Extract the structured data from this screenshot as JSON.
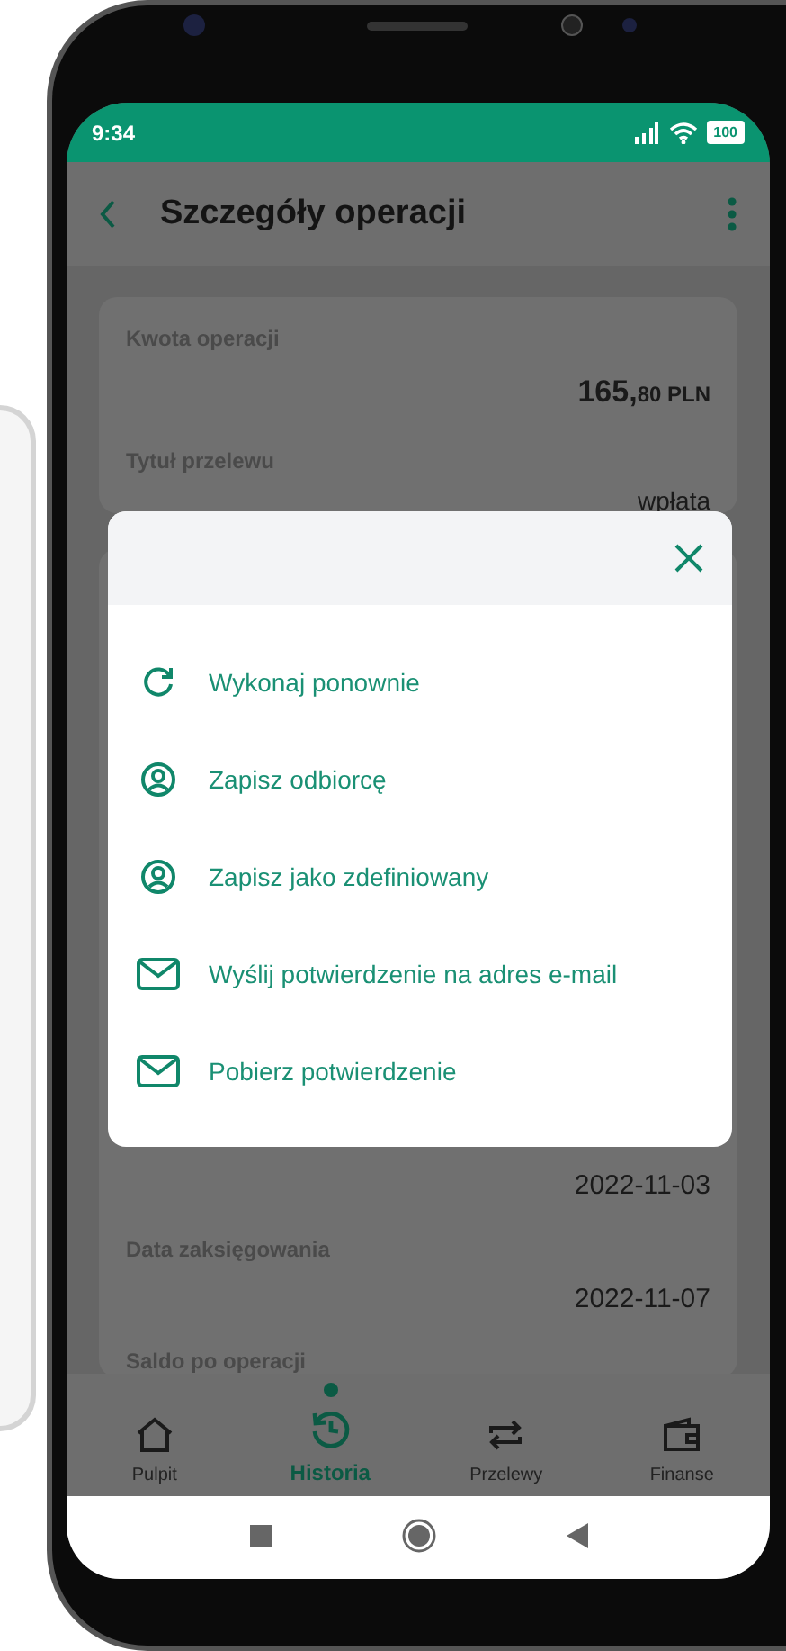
{
  "status_bar": {
    "time": "9:34",
    "battery": "100"
  },
  "header": {
    "title": "Szczegóły operacji"
  },
  "details_top": [
    {
      "label": "Kwota operacji",
      "amount": "165,",
      "amount_small": "80 PLN"
    },
    {
      "label": "Tytuł przelewu",
      "value": "wpłata"
    }
  ],
  "details_bottom": [
    {
      "value": "2022-11-03"
    },
    {
      "label": "Data zaksięgowania",
      "value": "2022-11-07"
    },
    {
      "label": "Saldo po operacji"
    }
  ],
  "menu": {
    "items": [
      {
        "kind": "repeat",
        "label": "Wykonaj ponownie"
      },
      {
        "kind": "person",
        "label": "Zapisz odbiorcę"
      },
      {
        "kind": "person",
        "label": "Zapisz jako zdefiniowany"
      },
      {
        "kind": "mail",
        "label": "Wyślij potwierdzenie na adres e-mail"
      },
      {
        "kind": "mail",
        "label": "Pobierz potwierdzenie"
      }
    ]
  },
  "bottom_nav": [
    {
      "kind": "home",
      "label": "Pulpit",
      "selected": false
    },
    {
      "kind": "history",
      "label": "Historia",
      "selected": true
    },
    {
      "kind": "transfer",
      "label": "Przelewy",
      "selected": false
    },
    {
      "kind": "wallet",
      "label": "Finanse",
      "selected": false
    }
  ]
}
